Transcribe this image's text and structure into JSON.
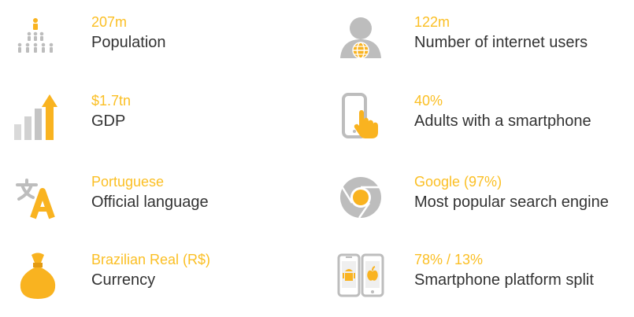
{
  "colors": {
    "accent": "#F9B320",
    "icon_gray": "#BDBDBD",
    "label_text": "#333333"
  },
  "stats": [
    {
      "icon": "population-icon",
      "value": "207m",
      "label": "Population"
    },
    {
      "icon": "internet-user-icon",
      "value": "122m",
      "label": "Number of internet users"
    },
    {
      "icon": "gdp-chart-icon",
      "value": "$1.7tn",
      "label": "GDP"
    },
    {
      "icon": "smartphone-touch-icon",
      "value": "40%",
      "label": "Adults with a smartphone"
    },
    {
      "icon": "translate-icon",
      "value": "Portuguese",
      "label": "Official language"
    },
    {
      "icon": "chrome-logo-icon",
      "value": "Google (97%)",
      "label": "Most popular search engine"
    },
    {
      "icon": "money-bag-icon",
      "value": "Brazilian Real (R$)",
      "label": "Currency"
    },
    {
      "icon": "android-apple-phones-icon",
      "value": "78% / 13%",
      "label": "Smartphone platform split"
    }
  ]
}
